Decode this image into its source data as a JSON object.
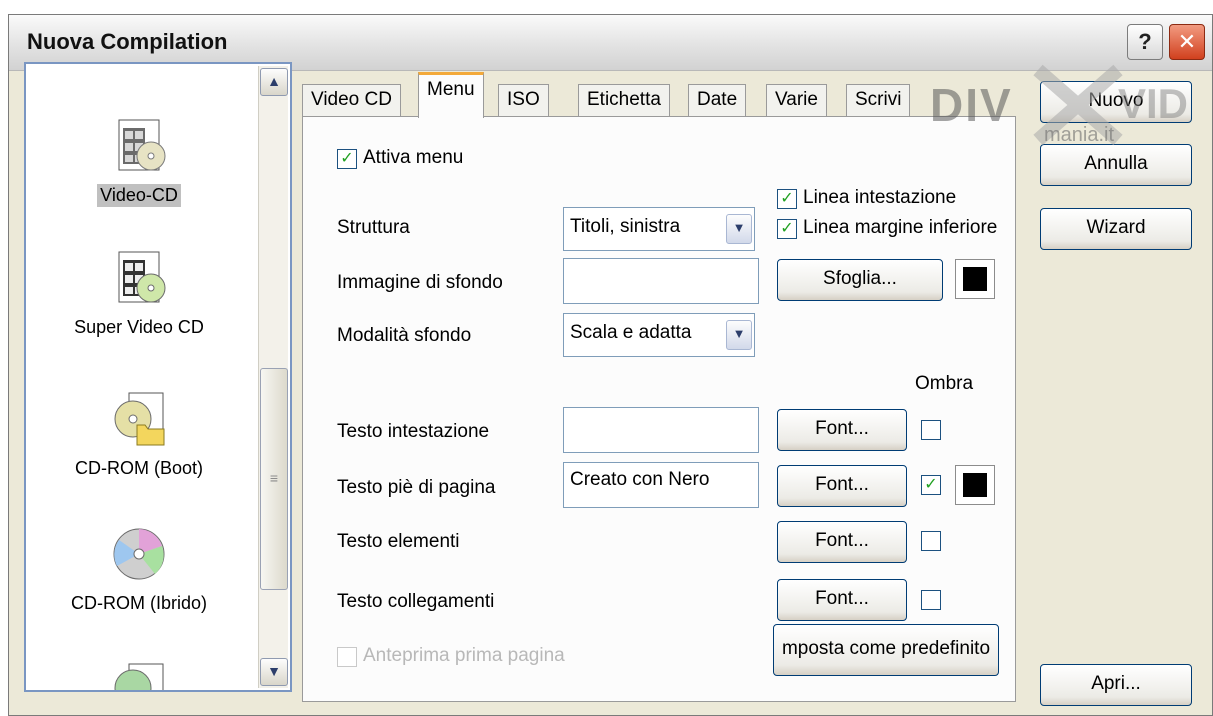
{
  "window": {
    "title": "Nuova Compilation"
  },
  "titlebar": {
    "help_glyph": "?",
    "close_glyph": "✕"
  },
  "left_list": {
    "items": [
      {
        "label": "Video-CD",
        "icon": "video-cd-icon",
        "selected": true
      },
      {
        "label": "Super Video CD",
        "icon": "super-video-cd-icon"
      },
      {
        "label": "CD-ROM (Boot)",
        "icon": "cd-rom-boot-icon"
      },
      {
        "label": "CD-ROM (Ibrido)",
        "icon": "cd-rom-hybrid-icon"
      }
    ],
    "scroll_up_glyph": "▲",
    "scroll_down_glyph": "▼",
    "thumb_grip": "≡"
  },
  "tabs": [
    {
      "label": "Video CD"
    },
    {
      "label": "Menu",
      "active": true
    },
    {
      "label": "ISO"
    },
    {
      "label": "Etichetta"
    },
    {
      "label": "Date"
    },
    {
      "label": "Varie"
    },
    {
      "label": "Scrivi"
    }
  ],
  "menu": {
    "enable_menu": {
      "label": "Attiva menu",
      "checked": true
    },
    "header_line": {
      "label": "Linea intestazione",
      "checked": true
    },
    "bottom_margin_line": {
      "label": "Linea margine inferiore",
      "checked": true
    },
    "structure": {
      "label": "Struttura",
      "value": "Titoli, sinistra"
    },
    "background_image": {
      "label": "Immagine di sfondo",
      "value": "",
      "browse": "Sfoglia...",
      "color": "#000000"
    },
    "background_mode": {
      "label": "Modalità sfondo",
      "value": "Scala e adatta"
    },
    "shadow_header": "Ombra",
    "header_text": {
      "label": "Testo intestazione",
      "value": "",
      "font": "Font...",
      "shadow": false
    },
    "footer_text": {
      "label": "Testo piè di pagina",
      "value": "Creato con Nero",
      "font": "Font...",
      "shadow": true,
      "color": "#000000"
    },
    "item_text": {
      "label": "Testo elementi",
      "font": "Font...",
      "shadow": false
    },
    "link_text": {
      "label": "Testo collegamenti",
      "font": "Font...",
      "shadow": false
    },
    "preview_first_page": {
      "label": "Anteprima prima pagina",
      "checked": false,
      "enabled": false
    },
    "set_default": "mposta come predefinito",
    "check_glyph": "✓",
    "combo_glyph": "▼"
  },
  "buttons": {
    "new": "Nuovo",
    "cancel": "Annulla",
    "wizard": "Wizard",
    "open": "Apri..."
  },
  "watermark": {
    "text1": "DIV",
    "text2": "VID",
    "text3": "mania.it"
  }
}
